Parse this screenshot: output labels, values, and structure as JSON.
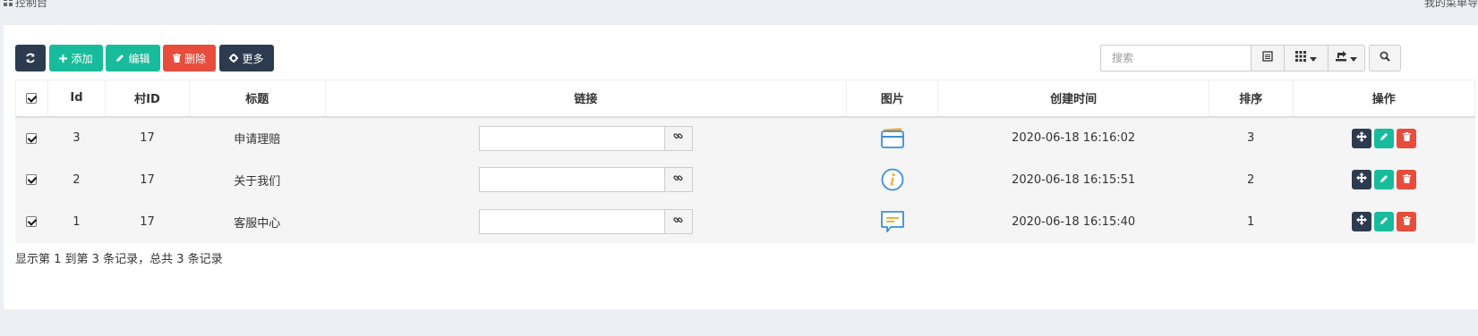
{
  "topbar": {
    "title": "控制台",
    "right_text": "我的菜单导"
  },
  "toolbar": {
    "refresh_icon": "refresh-icon",
    "add_label": "添加",
    "edit_label": "编辑",
    "delete_label": "删除",
    "more_label": "更多",
    "search_placeholder": "搜索"
  },
  "table": {
    "columns": [
      "Id",
      "村ID",
      "标题",
      "链接",
      "图片",
      "创建时间",
      "排序",
      "操作"
    ],
    "rows": [
      {
        "id": "3",
        "village_id": "17",
        "title": "申请理赔",
        "link": "",
        "image": "card-icon",
        "created": "2020-06-18 16:16:02",
        "sort": "3"
      },
      {
        "id": "2",
        "village_id": "17",
        "title": "关于我们",
        "link": "",
        "image": "info-icon",
        "created": "2020-06-18 16:15:51",
        "sort": "2"
      },
      {
        "id": "1",
        "village_id": "17",
        "title": "客服中心",
        "link": "",
        "image": "chat-icon",
        "created": "2020-06-18 16:15:40",
        "sort": "1"
      }
    ]
  },
  "footer": {
    "summary": "显示第 1 到第 3 条记录，总共 3 条记录"
  },
  "colors": {
    "dark": "#2c3b4f",
    "green": "#18bc9c",
    "red": "#e74c3c",
    "image_blue": "#3a8fd9",
    "image_orange": "#f5a623"
  }
}
